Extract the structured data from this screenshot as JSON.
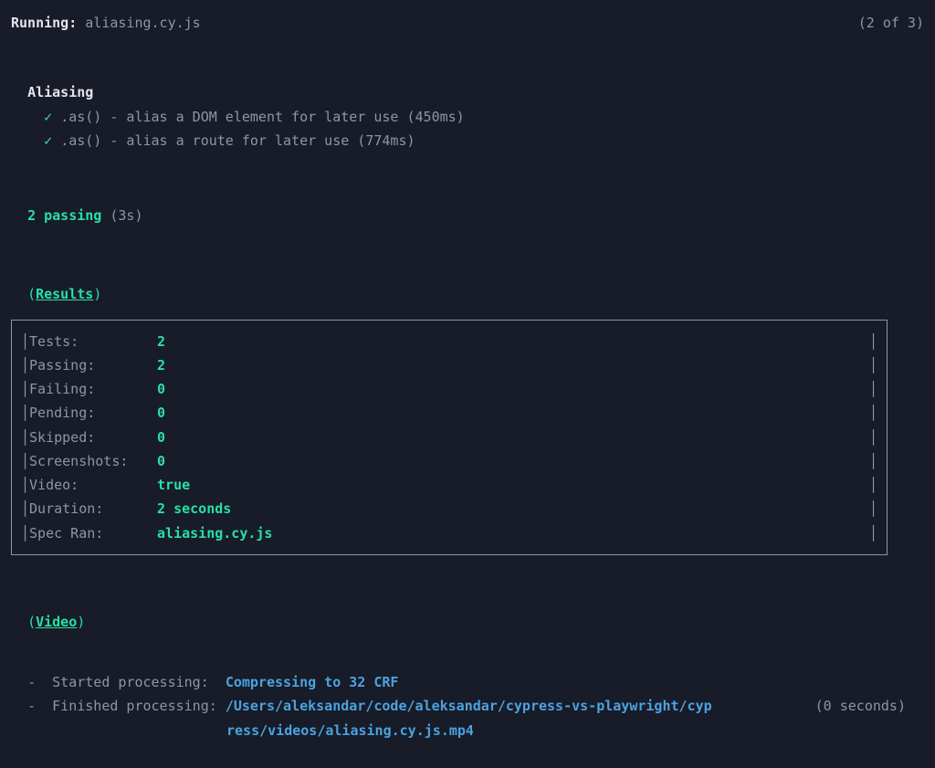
{
  "running": {
    "label": "Running:",
    "file": "aliasing.cy.js",
    "count": "(2 of 3)"
  },
  "suite": {
    "title": "Aliasing",
    "tests": [
      {
        "mark": "✓",
        "label": ".as() - alias a DOM element for later use (450ms)"
      },
      {
        "mark": "✓",
        "label": ".as() - alias a route for later use (774ms)"
      }
    ]
  },
  "summary": {
    "passing": "2 passing",
    "time": "(3s)"
  },
  "results": {
    "paren_open": "(",
    "label": "Results",
    "paren_close": ")",
    "rows": [
      {
        "label": "Tests:",
        "value": "2"
      },
      {
        "label": "Passing:",
        "value": "2"
      },
      {
        "label": "Failing:",
        "value": "0"
      },
      {
        "label": "Pending:",
        "value": "0"
      },
      {
        "label": "Skipped:",
        "value": "0"
      },
      {
        "label": "Screenshots:",
        "value": "0"
      },
      {
        "label": "Video:",
        "value": "true"
      },
      {
        "label": "Duration:",
        "value": "2 seconds"
      },
      {
        "label": "Spec Ran:",
        "value": "aliasing.cy.js"
      }
    ]
  },
  "video": {
    "paren_open": "(",
    "label": "Video",
    "paren_close": ")",
    "lines": {
      "started_dash": "-",
      "started_label": "Started processing:",
      "started_value": "Compressing to 32 CRF",
      "finished_dash": "-",
      "finished_label": "Finished processing:",
      "finished_value_1": "/Users/aleksandar/code/aleksandar/cypress-vs-playwright/cyp",
      "finished_value_2": "ress/videos/aliasing.cy.js.mp4",
      "finished_time": "(0 seconds)"
    }
  }
}
